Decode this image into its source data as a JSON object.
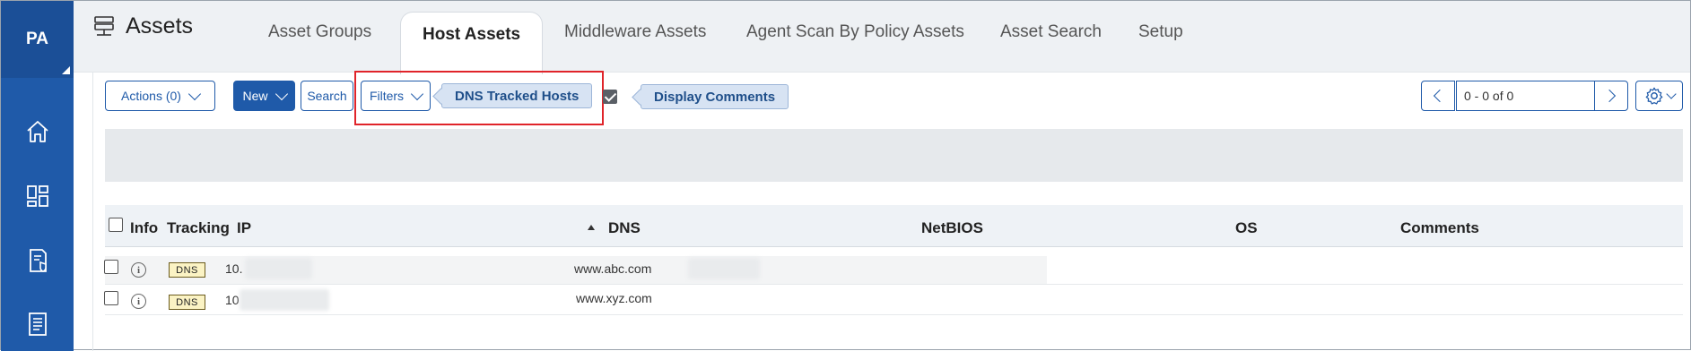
{
  "rail": {
    "avatar": "PA",
    "icons": [
      "home-icon",
      "dashboard-icon",
      "policy-report-icon",
      "document-icon"
    ],
    "color": "#1f5aa9"
  },
  "header": {
    "title": "Assets",
    "tabs": [
      {
        "label": "Asset Groups",
        "active": false
      },
      {
        "label": "Host Assets",
        "active": true
      },
      {
        "label": "Middleware Assets",
        "active": false
      },
      {
        "label": "Agent Scan By Policy Assets",
        "active": false
      },
      {
        "label": "Asset Search",
        "active": false
      },
      {
        "label": "Setup",
        "active": false
      }
    ]
  },
  "toolbar": {
    "actions_label": "Actions (0)",
    "new_label": "New",
    "search_label": "Search",
    "filters_label": "Filters",
    "filter_chip": "DNS Tracked Hosts",
    "display_comments_checked": true,
    "display_comments_label": "Display Comments",
    "pager_range": "0 - 0 of 0"
  },
  "table": {
    "columns": [
      "Info",
      "Tracking",
      "IP",
      "DNS",
      "NetBIOS",
      "OS",
      "Comments"
    ],
    "sort_column": "DNS",
    "rows": [
      {
        "tracking": "DNS",
        "ip": "10.",
        "dns": "www.abc.com"
      },
      {
        "tracking": "DNS",
        "ip": "10",
        "dns": "www.xyz.com"
      }
    ]
  },
  "colors": {
    "accent": "#1f5aa9",
    "highlight_border": "#e0242a",
    "chip_bg": "#d7e3f3"
  }
}
